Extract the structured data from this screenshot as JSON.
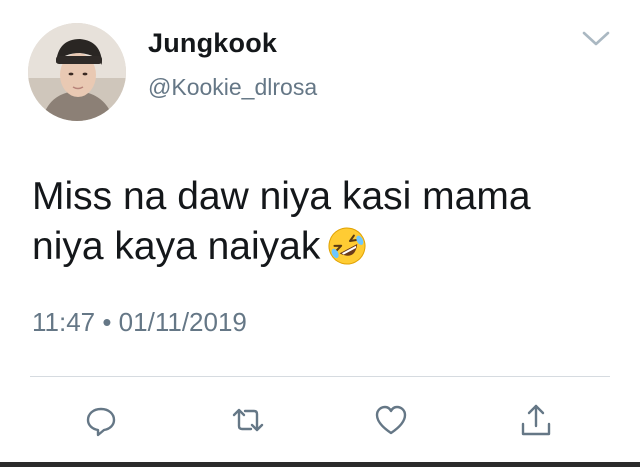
{
  "user": {
    "display_name": "Jungkook",
    "handle": "@Kookie_dlrosa",
    "avatar": "profile-photo"
  },
  "header": {
    "menu_icon": "chevron-down-icon"
  },
  "tweet": {
    "line1": "Miss na daw niya kasi mama",
    "line2": "niya kaya naiyak",
    "emoji": "rolling-on-the-floor-laughing-emoji",
    "timestamp": "11:47 • 01/11/2019"
  },
  "actions": [
    {
      "name": "reply",
      "icon": "reply-bubble-icon"
    },
    {
      "name": "retweet",
      "icon": "retweet-icon"
    },
    {
      "name": "like",
      "icon": "heart-icon"
    },
    {
      "name": "share",
      "icon": "share-icon"
    }
  ],
  "colors": {
    "text": "#14171a",
    "secondary": "#657786",
    "icon": "#657786",
    "divider": "#d6dbe0"
  }
}
